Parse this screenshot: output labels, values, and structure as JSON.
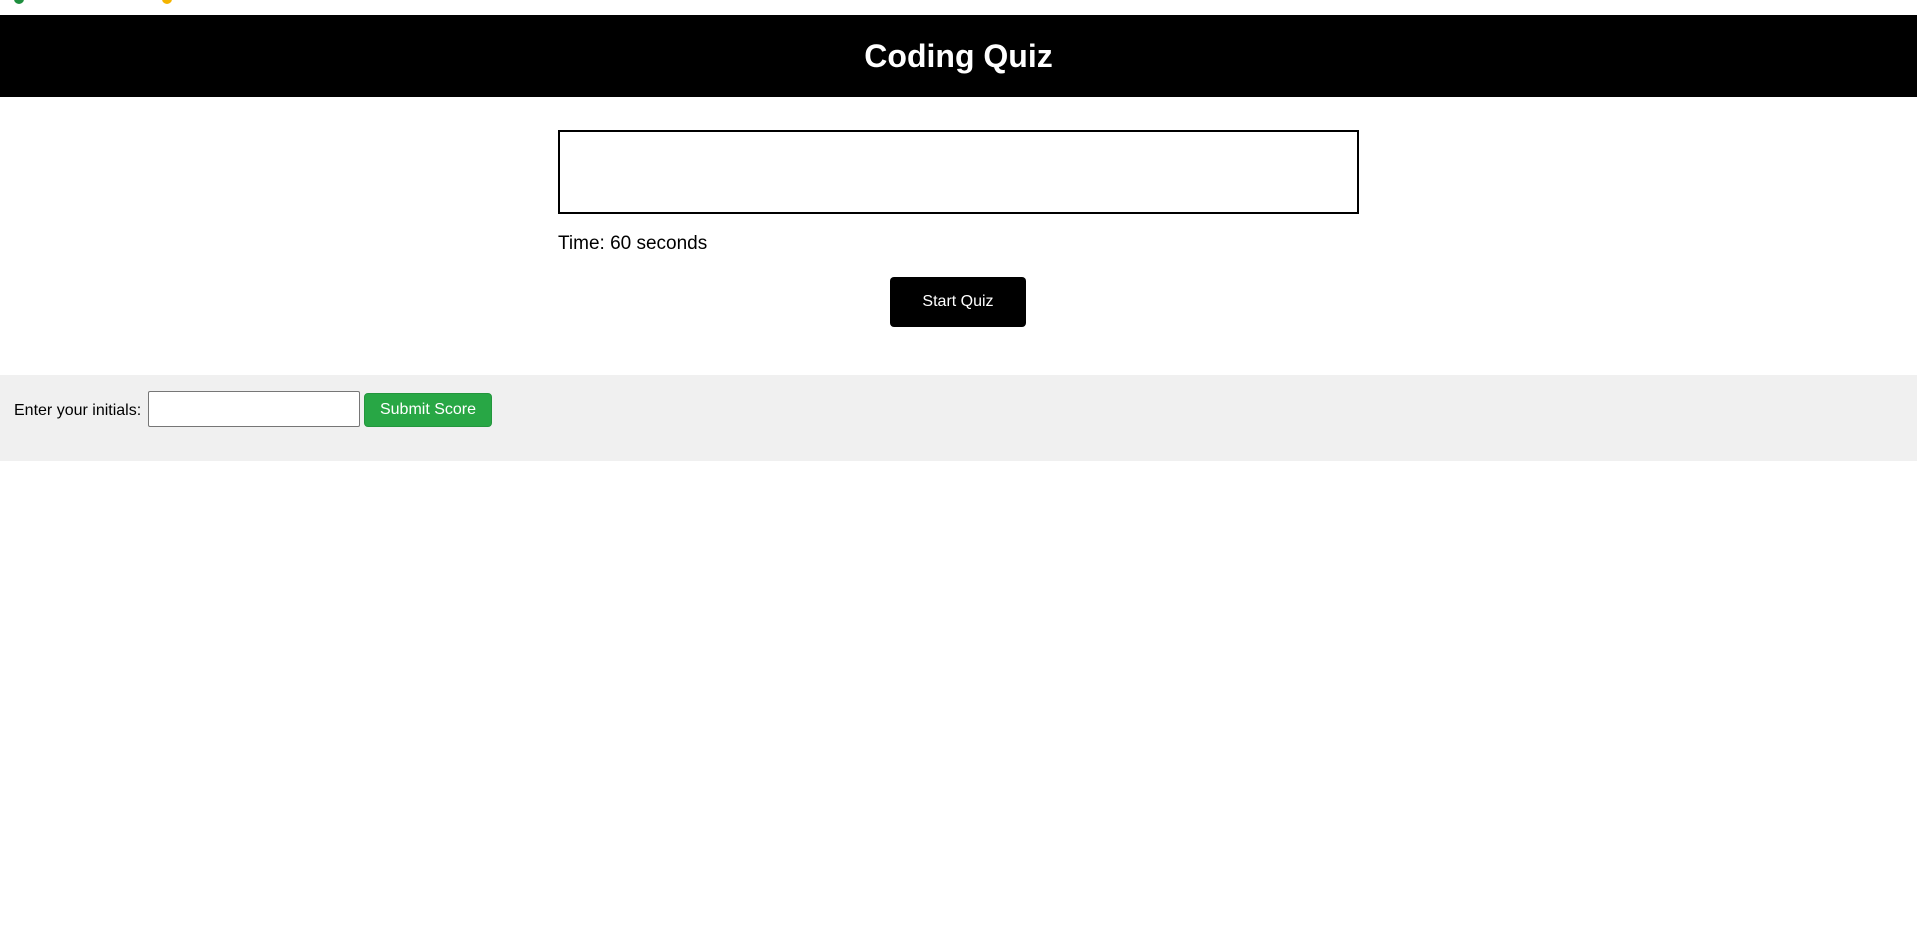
{
  "app": {
    "title": "Coding Quiz"
  },
  "quiz": {
    "question_text": "",
    "timer_text": "Time: 60 seconds",
    "timer_seconds": 60,
    "start_button_label": "Start Quiz"
  },
  "score_form": {
    "initials_label": "Enter your initials:",
    "initials_value": "",
    "submit_button_label": "Submit Score"
  },
  "colors": {
    "header_background": "#000000",
    "start_button_background": "#000000",
    "submit_button_background": "#28a745",
    "score_bar_background": "#f0f0f0"
  }
}
